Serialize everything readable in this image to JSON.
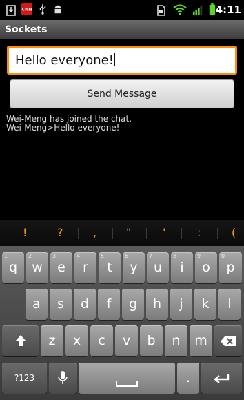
{
  "status_bar": {
    "time": "4:11",
    "icons": [
      "download-icon",
      "cnn-icon",
      "usb-icon",
      "android-icon",
      "sim-icon",
      "wifi-icon",
      "signal-icon",
      "battery-icon"
    ]
  },
  "app": {
    "title": "Sockets"
  },
  "message_field": {
    "value": "Hello everyone!"
  },
  "send_button": {
    "label": "Send Message"
  },
  "chat_log": [
    "Wei-Meng has joined the chat.",
    "Wei-Meng>Hello everyone!"
  ],
  "suggestions": [
    "!",
    "?",
    ",",
    "\"",
    "'",
    ":",
    "("
  ],
  "keyboard": {
    "row1": [
      {
        "label": "q",
        "hint": "1"
      },
      {
        "label": "w",
        "hint": "2"
      },
      {
        "label": "e",
        "hint": "3"
      },
      {
        "label": "r",
        "hint": "4"
      },
      {
        "label": "t",
        "hint": "5"
      },
      {
        "label": "y",
        "hint": "6"
      },
      {
        "label": "u",
        "hint": "7"
      },
      {
        "label": "i",
        "hint": "8"
      },
      {
        "label": "o",
        "hint": "9"
      },
      {
        "label": "p",
        "hint": "0"
      }
    ],
    "row2": [
      "a",
      "s",
      "d",
      "f",
      "g",
      "h",
      "j",
      "k",
      "l"
    ],
    "row3": [
      "z",
      "x",
      "c",
      "v",
      "b",
      "n",
      "m"
    ],
    "symbols_label": "?123",
    "period_label": "."
  },
  "colors": {
    "accent": "#ff8f00",
    "suggestion": "#f0a020",
    "battery": "#5fd32b"
  }
}
